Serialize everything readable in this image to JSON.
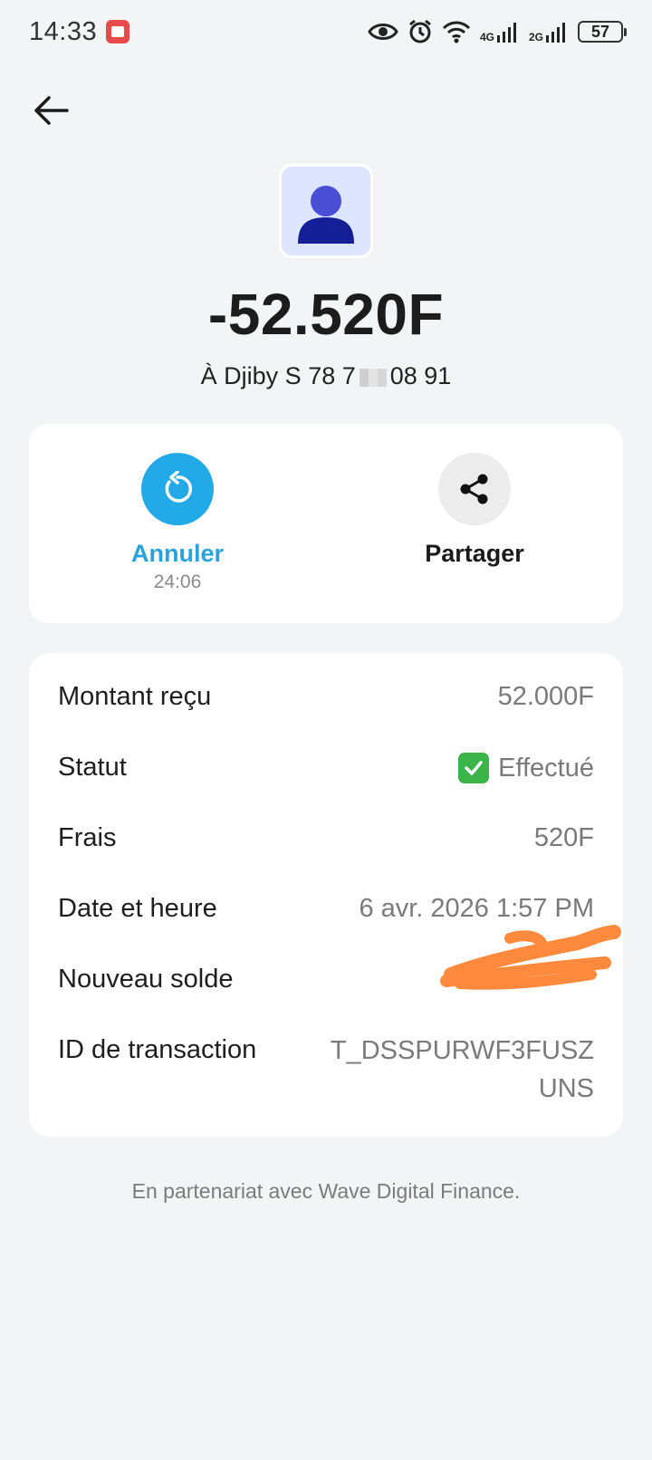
{
  "status_bar": {
    "time": "14:33",
    "network_1": "4G",
    "network_2": "2G",
    "battery": "57"
  },
  "header": {
    "back_icon": "arrow-left-icon"
  },
  "transaction": {
    "amount": "-52.520F",
    "recipient_prefix": "À Djiby S 78 7",
    "recipient_suffix": "08 91"
  },
  "actions": {
    "cancel_label": "Annuler",
    "cancel_timer": "24:06",
    "share_label": "Partager"
  },
  "details": {
    "amount_received_label": "Montant reçu",
    "amount_received_value": "52.000F",
    "status_label": "Statut",
    "status_value": "Effectué",
    "fees_label": "Frais",
    "fees_value": "520F",
    "datetime_label": "Date et heure",
    "datetime_value": "6 avr. 2026 1:57 PM",
    "new_balance_label": "Nouveau solde",
    "transaction_id_label": "ID de transaction",
    "transaction_id_value": "T_DSSPURWF3FUSZ UNS"
  },
  "footer": {
    "text": "En partenariat avec Wave Digital Finance."
  },
  "colors": {
    "accent": "#22a9e8",
    "success": "#3bb54a",
    "background": "#f3f4f6",
    "redaction": "#ff8a3d"
  }
}
